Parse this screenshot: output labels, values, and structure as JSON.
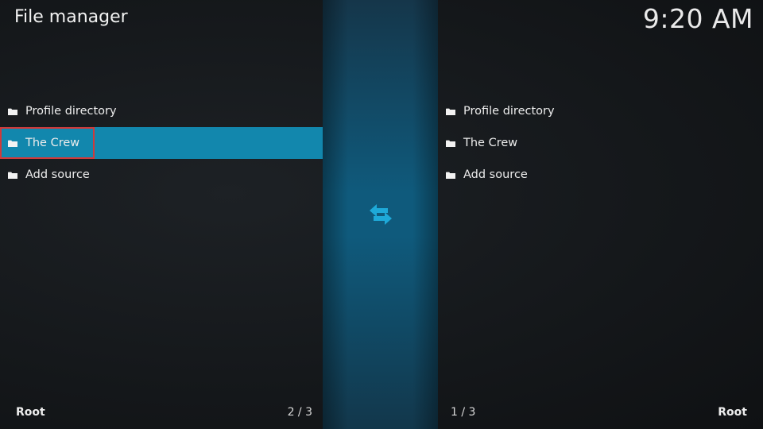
{
  "header": {
    "title": "File manager",
    "clock": "9:20 AM"
  },
  "left_pane": {
    "items": [
      {
        "label": "Profile directory",
        "icon": "folder-icon"
      },
      {
        "label": "The Crew",
        "icon": "folder-icon"
      },
      {
        "label": "Add source",
        "icon": "folder-icon"
      }
    ],
    "focused_index": 1,
    "path": "Root",
    "count": "2 / 3"
  },
  "right_pane": {
    "items": [
      {
        "label": "Profile directory",
        "icon": "folder-icon"
      },
      {
        "label": "The Crew",
        "icon": "folder-icon"
      },
      {
        "label": "Add source",
        "icon": "folder-icon"
      }
    ],
    "path": "Root",
    "count": "1 / 3"
  },
  "divider": {
    "icon": "swap-arrows-icon"
  },
  "colors": {
    "focus_bg": "#1287ad",
    "accent_arrow": "#1ea9d8",
    "annotation_red": "#d03a3a"
  }
}
